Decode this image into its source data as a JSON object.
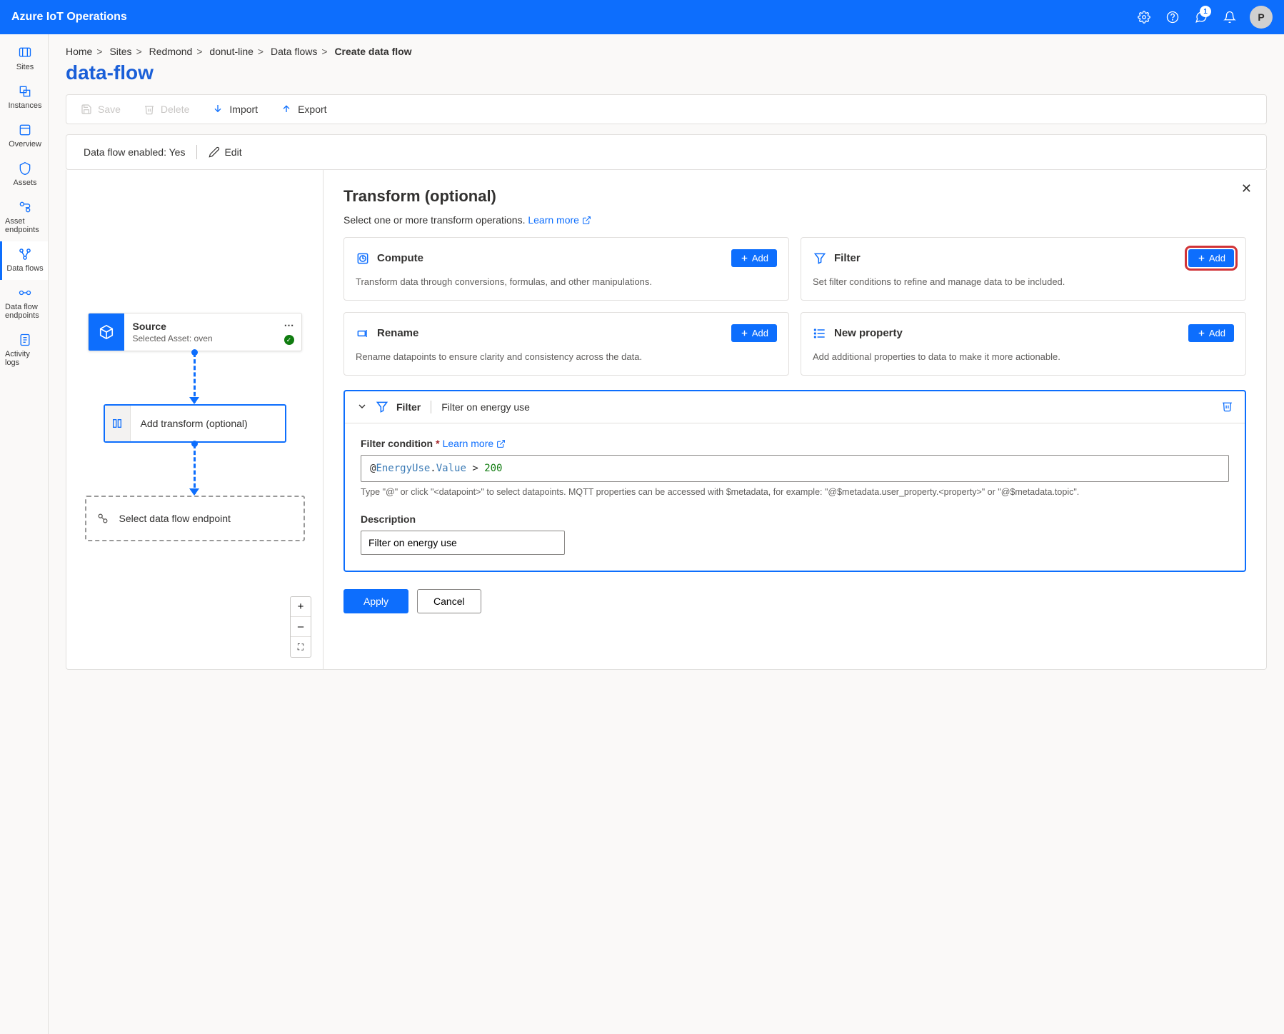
{
  "header": {
    "brand": "Azure IoT Operations",
    "feedback_badge": "1",
    "avatar_initial": "P"
  },
  "sidebar": {
    "items": [
      {
        "label": "Sites"
      },
      {
        "label": "Instances"
      },
      {
        "label": "Overview"
      },
      {
        "label": "Assets"
      },
      {
        "label": "Asset endpoints"
      },
      {
        "label": "Data flows"
      },
      {
        "label": "Data flow endpoints"
      },
      {
        "label": "Activity logs"
      }
    ]
  },
  "breadcrumb": {
    "items": [
      "Home",
      "Sites",
      "Redmond",
      "donut-line",
      "Data flows"
    ],
    "current": "Create data flow"
  },
  "page_title": "data-flow",
  "toolbar": {
    "save": "Save",
    "delete": "Delete",
    "import": "Import",
    "export": "Export"
  },
  "statusbar": {
    "label": "Data flow enabled: Yes",
    "edit": "Edit"
  },
  "canvas": {
    "source": {
      "title": "Source",
      "subtitle": "Selected Asset: oven"
    },
    "transform": {
      "label": "Add transform (optional)"
    },
    "endpoint": {
      "label": "Select data flow endpoint"
    },
    "zoom_in": "+",
    "zoom_out": "–"
  },
  "panel": {
    "title": "Transform (optional)",
    "subtitle": "Select one or more transform operations.",
    "learn_more": "Learn more",
    "cards": {
      "compute": {
        "title": "Compute",
        "desc": "Transform data through conversions, formulas, and other manipulations.",
        "add": "Add"
      },
      "filter": {
        "title": "Filter",
        "desc": "Set filter conditions to refine and manage data to be included.",
        "add": "Add"
      },
      "rename": {
        "title": "Rename",
        "desc": "Rename datapoints to ensure clarity and consistency across the data.",
        "add": "Add"
      },
      "newprop": {
        "title": "New property",
        "desc": "Add additional properties to data to make it more actionable.",
        "add": "Add"
      }
    },
    "filter_zone": {
      "badge": "Filter",
      "name": "Filter on energy use",
      "condition_label": "Filter condition",
      "learn_more": "Learn more",
      "condition_at": "@",
      "condition_var": "EnergyUse",
      "condition_dot": ".",
      "condition_prop": "Value",
      "condition_op_suffix": " > ",
      "condition_num": "200",
      "hint": "Type \"@\" or click \"<datapoint>\" to select datapoints. MQTT properties can be accessed with $metadata, for example: \"@$metadata.user_property.<property>\" or \"@$metadata.topic\".",
      "description_label": "Description",
      "description_value": "Filter on energy use"
    },
    "apply": "Apply",
    "cancel": "Cancel"
  }
}
